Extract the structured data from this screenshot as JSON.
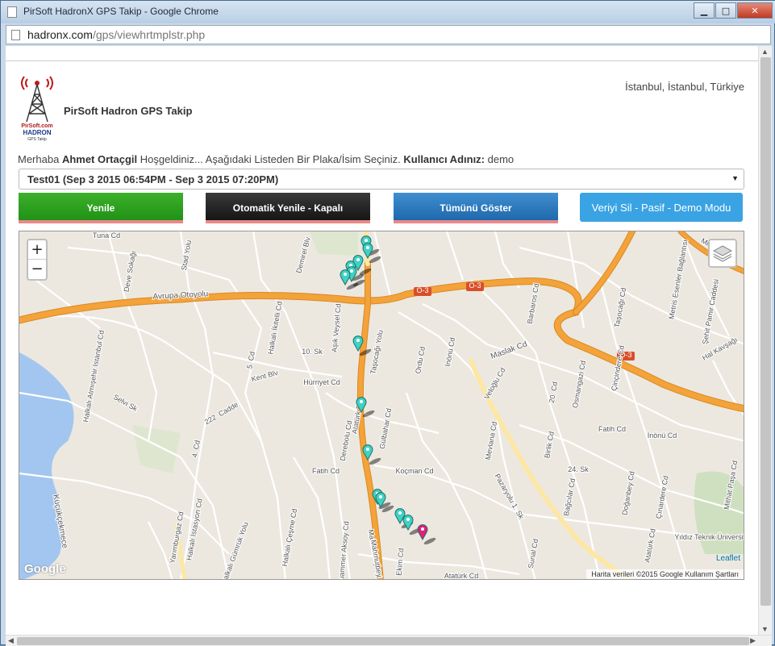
{
  "browser": {
    "window_title": "PirSoft HadronX GPS Takip - Google Chrome",
    "url_host": "hadronx.com",
    "url_path": "/gps/viewhrtmplstr.php",
    "min_glyph": "▁",
    "max_glyph": "□",
    "close_glyph": "✕"
  },
  "header": {
    "site_title": "PirSoft Hadron GPS Takip",
    "location": "İstanbul, İstanbul, Türkiye",
    "logo_brand_line1": "PirSoft.com",
    "logo_brand_line2": "HADRON",
    "logo_brand_line3": "GPS Takip"
  },
  "welcome": {
    "greeting": "Merhaba",
    "user_name": "Ahmet Ortaçgil",
    "message": "Hoşgeldiniz... Aşağıdaki Listeden Bir Plaka/İsim Seçiniz.",
    "username_label": "Kullanıcı Adınız:",
    "username_value": "demo"
  },
  "route_select": {
    "selected": "Test01 (Sep 3 2015 06:54PM - Sep 3 2015 07:20PM)"
  },
  "buttons": {
    "refresh": "Yenile",
    "auto_refresh": "Otomatik Yenile - Kapalı",
    "show_all": "Tümünü Göster",
    "delete_data": "Veriyi Sil - Pasif - Demo Modu"
  },
  "map": {
    "zoom_in": "+",
    "zoom_out": "−",
    "attribution": "Harita verileri ©2015 Google   Kullanım Şartları",
    "leaflet_label": "Leaflet",
    "google_logo": "Google",
    "colors": {
      "highway": "#f4a23a",
      "road": "#ffffff",
      "land": "#ece8e0",
      "water": "#a3c6f0",
      "marker": "#3fd1c4",
      "marker_end": "#e0207a"
    },
    "labels": [
      {
        "text": "Avrupa Otoyolu"
      },
      {
        "text": "O-3"
      },
      {
        "text": "O-3"
      },
      {
        "text": "O-3"
      },
      {
        "text": "Maslak Cd"
      },
      {
        "text": "Tuna Cd"
      },
      {
        "text": "Deve Sokağı"
      },
      {
        "text": "Stad Yolu"
      },
      {
        "text": "Demirel Blv"
      },
      {
        "text": "Halkalı İkitelli Cd"
      },
      {
        "text": "Aşık Veysel Cd"
      },
      {
        "text": "10. Sk"
      },
      {
        "text": "Hürriyet Cd"
      },
      {
        "text": "Kent Blv"
      },
      {
        "text": "222. Cadde"
      },
      {
        "text": "Taşocağı Yolu"
      },
      {
        "text": "Ordu Cd"
      },
      {
        "text": "İnönü Cd"
      },
      {
        "text": "Veloğlu Cd"
      },
      {
        "text": "Osmangazi Cd"
      },
      {
        "text": "20. Cd"
      },
      {
        "text": "Fatih Cd"
      },
      {
        "text": "Fatih Cd"
      },
      {
        "text": "İnönü Cd"
      },
      {
        "text": "Koçman Cd"
      },
      {
        "text": "Gülbahar Cd"
      },
      {
        "text": "Atatürk Blv"
      },
      {
        "text": "Mahmutbey Cd"
      },
      {
        "text": "Mevlana Cd"
      },
      {
        "text": "24. Sk"
      },
      {
        "text": "Bağcılar Cd"
      },
      {
        "text": "Pazaryolu 1. Sk"
      },
      {
        "text": "Doğanbey Cd"
      },
      {
        "text": "Çınardere Cd"
      },
      {
        "text": "Mahmutbey"
      },
      {
        "text": "Ekim Cd"
      },
      {
        "text": "Atatürk Cd"
      },
      {
        "text": "Atatürk Cd"
      },
      {
        "text": "Sunal Cd"
      },
      {
        "text": "Yıldız Teknik Üniversitesi"
      },
      {
        "text": "Küçükçekmece"
      },
      {
        "text": "Halkalı Atmışehir İstanbul Cd"
      },
      {
        "text": "Selvi Sk"
      },
      {
        "text": "5. Cd"
      },
      {
        "text": "4. Cd"
      },
      {
        "text": "Yarımburgaz Cd"
      },
      {
        "text": "Halkalı İstasyon Cd"
      },
      {
        "text": "Halkalı Gümrük Yolu"
      },
      {
        "text": "Muammer Aksoy Cd"
      },
      {
        "text": "Halkalı Çeşme Cd"
      },
      {
        "text": "Derebolu Cd"
      },
      {
        "text": "Barbaros Cd"
      },
      {
        "text": "Taşocağı Cd"
      },
      {
        "text": "Metris Esenler Bağlantısı"
      },
      {
        "text": "Şehit Pamir Caddesi"
      },
      {
        "text": "Hal Kavşağı"
      },
      {
        "text": "Çinçindere Cd"
      },
      {
        "text": "Mithat Paşa Cd"
      },
      {
        "text": "Miller Cd"
      },
      {
        "text": "Birlik Cd"
      }
    ]
  }
}
